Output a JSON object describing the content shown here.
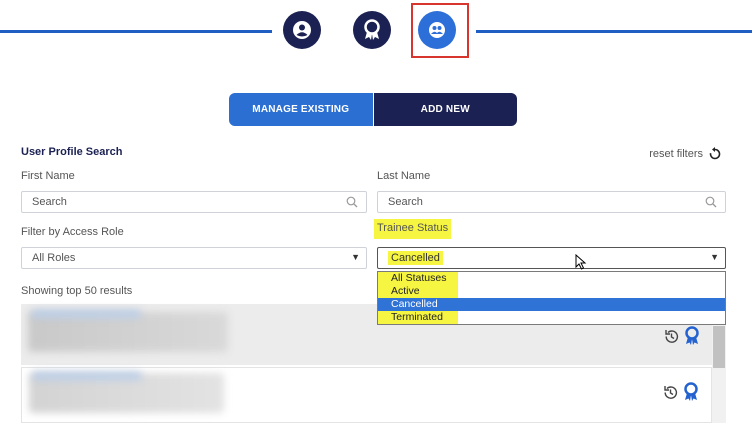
{
  "tabs": {
    "manage_label": "MANAGE EXISTING",
    "add_label": "ADD NEW"
  },
  "search": {
    "title": "User Profile Search",
    "reset_label": "reset filters",
    "first_name_label": "First Name",
    "first_name_placeholder": "Search",
    "last_name_label": "Last Name",
    "last_name_placeholder": "Search",
    "role_label": "Filter by Access Role",
    "role_value": "All Roles",
    "status_label": "Trainee Status",
    "status_value": "Cancelled",
    "status_options": [
      "All Statuses",
      "Active",
      "Cancelled",
      "Terminated"
    ],
    "results_text": "Showing top 50 results"
  },
  "colors": {
    "navy": "#1b2152",
    "blue": "#2b6fd2",
    "highlight": "#f6f542",
    "red_box": "#d9352f"
  },
  "icons": [
    "user-circle-icon",
    "award-badge-icon",
    "users-group-icon",
    "search-icon",
    "reset-icon",
    "history-icon",
    "ribbon-icon"
  ]
}
